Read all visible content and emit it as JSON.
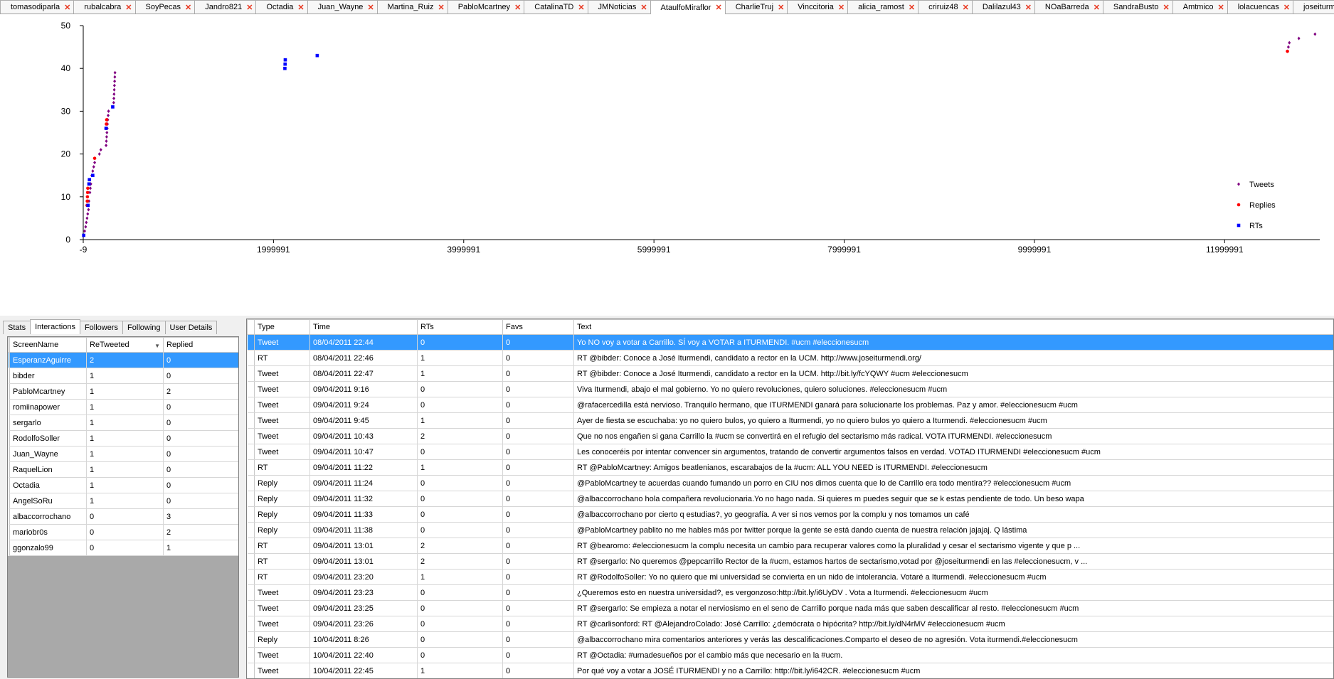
{
  "tabs": [
    {
      "label": "tomasodiparla",
      "active": false
    },
    {
      "label": "rubalcabra",
      "active": false
    },
    {
      "label": "SoyPecas",
      "active": false
    },
    {
      "label": "Jandro821",
      "active": false
    },
    {
      "label": "Octadia",
      "active": false
    },
    {
      "label": "Juan_Wayne",
      "active": false
    },
    {
      "label": "Martina_Ruiz",
      "active": false
    },
    {
      "label": "PabloMcartney",
      "active": false
    },
    {
      "label": "CatalinaTD",
      "active": false
    },
    {
      "label": "JMNoticias",
      "active": false
    },
    {
      "label": "AtaulfoMiraflor",
      "active": true
    },
    {
      "label": "CharlieTruj",
      "active": false
    },
    {
      "label": "Vinccitoria",
      "active": false
    },
    {
      "label": "alicia_ramost",
      "active": false
    },
    {
      "label": "criruiz48",
      "active": false
    },
    {
      "label": "Dalilazul43",
      "active": false
    },
    {
      "label": "NOaBarreda",
      "active": false
    },
    {
      "label": "SandraBusto",
      "active": false
    },
    {
      "label": "Amtmico",
      "active": false
    },
    {
      "label": "lolacuencas",
      "active": false
    },
    {
      "label": "joseiturmendi",
      "active": false
    }
  ],
  "chart_data": {
    "type": "scatter",
    "xlim": [
      -9,
      12999991
    ],
    "ylim": [
      0,
      50
    ],
    "x_ticks": [
      -9,
      1999991,
      3999991,
      5999991,
      7999991,
      9999991,
      11999991
    ],
    "x_tick_labels": [
      "-9",
      "1999991",
      "3999991",
      "5999991",
      "7999991",
      "9999991",
      "11999991"
    ],
    "y_ticks": [
      0,
      10,
      20,
      30,
      40,
      50
    ],
    "y_tick_labels": [
      "0",
      "10",
      "20",
      "30",
      "40",
      "50"
    ],
    "legend_position": "right",
    "legend": [
      {
        "name": "Tweets",
        "color": "#800080",
        "marker": "diamond"
      },
      {
        "name": "Replies",
        "color": "#ff0000",
        "marker": "circle"
      },
      {
        "name": "RTs",
        "color": "#0000ff",
        "marker": "square"
      }
    ],
    "series": [
      {
        "name": "Tweets",
        "color": "#800080",
        "marker": "diamond",
        "points": [
          [
            5000,
            1
          ],
          [
            15000,
            2
          ],
          [
            25000,
            3
          ],
          [
            32000,
            4
          ],
          [
            40000,
            5
          ],
          [
            47000,
            6
          ],
          [
            55000,
            7
          ],
          [
            60000,
            9
          ],
          [
            70000,
            11
          ],
          [
            75000,
            12
          ],
          [
            80000,
            13
          ],
          [
            90000,
            15
          ],
          [
            100000,
            16
          ],
          [
            110000,
            17
          ],
          [
            120000,
            18
          ],
          [
            170000,
            20
          ],
          [
            185000,
            21
          ],
          [
            240000,
            22
          ],
          [
            243000,
            23
          ],
          [
            246000,
            24
          ],
          [
            249000,
            25
          ],
          [
            252000,
            26
          ],
          [
            255000,
            27
          ],
          [
            258000,
            28
          ],
          [
            262000,
            29
          ],
          [
            266000,
            30
          ],
          [
            320000,
            32
          ],
          [
            322000,
            33
          ],
          [
            324000,
            34
          ],
          [
            326000,
            35
          ],
          [
            328000,
            36
          ],
          [
            330000,
            37
          ],
          [
            332000,
            38
          ],
          [
            334000,
            39
          ],
          [
            12660000,
            44
          ],
          [
            12670000,
            45
          ],
          [
            12680000,
            46
          ],
          [
            12780000,
            47
          ],
          [
            12950000,
            48
          ]
        ]
      },
      {
        "name": "Replies",
        "color": "#ff0000",
        "marker": "circle",
        "points": [
          [
            40000,
            8
          ],
          [
            42000,
            9
          ],
          [
            44000,
            10
          ],
          [
            46000,
            11
          ],
          [
            48000,
            12
          ],
          [
            120000,
            19
          ],
          [
            240000,
            26
          ],
          [
            243000,
            27
          ],
          [
            246000,
            28
          ],
          [
            12660000,
            44
          ]
        ]
      },
      {
        "name": "RTs",
        "color": "#0000ff",
        "marker": "square",
        "points": [
          [
            5000,
            1
          ],
          [
            50000,
            8
          ],
          [
            60000,
            13
          ],
          [
            65000,
            14
          ],
          [
            100000,
            15
          ],
          [
            240000,
            26
          ],
          [
            310000,
            31
          ],
          [
            2120000,
            40
          ],
          [
            2122000,
            41
          ],
          [
            2124000,
            42
          ],
          [
            2460000,
            43
          ]
        ]
      }
    ]
  },
  "left_tabs": [
    {
      "label": "Stats",
      "active": false
    },
    {
      "label": "Interactions",
      "active": true
    },
    {
      "label": "Followers",
      "active": false
    },
    {
      "label": "Following",
      "active": false
    },
    {
      "label": "User Details",
      "active": false
    }
  ],
  "interactions": {
    "columns": [
      "ScreenName",
      "ReTweeted",
      "Replied"
    ],
    "rows": [
      [
        "EsperanzAguirre",
        "2",
        "0"
      ],
      [
        "bibder",
        "1",
        "0"
      ],
      [
        "PabloMcartney",
        "1",
        "2"
      ],
      [
        "romiinapower",
        "1",
        "0"
      ],
      [
        "sergarlo",
        "1",
        "0"
      ],
      [
        "RodolfoSoller",
        "1",
        "0"
      ],
      [
        "Juan_Wayne",
        "1",
        "0"
      ],
      [
        "RaquelLion",
        "1",
        "0"
      ],
      [
        "Octadia",
        "1",
        "0"
      ],
      [
        "AngelSoRu",
        "1",
        "0"
      ],
      [
        "albaccorrochano",
        "0",
        "3"
      ],
      [
        "mariobr0s",
        "0",
        "2"
      ],
      [
        "ggonzalo99",
        "0",
        "1"
      ]
    ]
  },
  "tweets": {
    "columns": [
      "Type",
      "Time",
      "RTs",
      "Favs",
      "Text"
    ],
    "rows": [
      [
        "Tweet",
        "08/04/2011 22:44",
        "0",
        "0",
        "Yo NO voy a votar a Carrillo. SÍ voy a VOTAR a ITURMENDI. #ucm #eleccionesucm"
      ],
      [
        "RT",
        "08/04/2011 22:46",
        "1",
        "0",
        "RT @bibder: Conoce a José Iturmendi, candidato a rector en la UCM. http://www.joseiturmendi.org/"
      ],
      [
        "Tweet",
        "08/04/2011 22:47",
        "1",
        "0",
        "RT @bibder: Conoce a José Iturmendi, candidato a rector en la UCM. http://bit.ly/fcYQWY #ucm #eleccionesucm"
      ],
      [
        "Tweet",
        "09/04/2011 9:16",
        "0",
        "0",
        "Viva Iturmendi, abajo el mal gobierno. Yo no quiero revoluciones, quiero soluciones. #eleccionesucm #ucm"
      ],
      [
        "Tweet",
        "09/04/2011 9:24",
        "0",
        "0",
        "@rafacercedilla está nervioso. Tranquilo hermano, que ITURMENDI ganará para solucionarte los problemas. Paz y amor. #eleccionesucm #ucm"
      ],
      [
        "Tweet",
        "09/04/2011 9:45",
        "1",
        "0",
        "Ayer de fiesta se escuchaba: yo no quiero bulos, yo quiero a Iturmendi, yo no quiero bulos yo quiero a Iturmendi. #eleccionesucm #ucm"
      ],
      [
        "Tweet",
        "09/04/2011 10:43",
        "2",
        "0",
        "Que no nos engañen si gana Carrillo la #ucm se convertirá en el refugio del sectarismo más radical. VOTA ITURMENDI. #eleccionesucm"
      ],
      [
        "Tweet",
        "09/04/2011 10:47",
        "0",
        "0",
        "Les conoceréis por intentar convencer sin argumentos, tratando de convertir argumentos falsos en verdad. VOTAD ITURMENDI #eleccionesucm #ucm"
      ],
      [
        "RT",
        "09/04/2011 11:22",
        "1",
        "0",
        "RT @PabloMcartney: Amigos beatlenianos, escarabajos de la #ucm: ALL YOU NEED is ITURMENDI. #eleccionesucm"
      ],
      [
        "Reply",
        "09/04/2011 11:24",
        "0",
        "0",
        "@PabloMcartney te acuerdas cuando fumando un porro en CIU nos dimos cuenta que lo de Carrillo era todo mentira?? #eleccionesucm #ucm"
      ],
      [
        "Reply",
        "09/04/2011 11:32",
        "0",
        "0",
        "@albaccorrochano hola compañera revolucionaria.Yo no hago nada. Si quieres m puedes seguir que se k estas pendiente de todo. Un beso wapa"
      ],
      [
        "Reply",
        "09/04/2011 11:33",
        "0",
        "0",
        "@albaccorrochano por cierto q estudias?, yo geografía. A ver si nos vemos por la complu y nos tomamos un café"
      ],
      [
        "Reply",
        "09/04/2011 11:38",
        "0",
        "0",
        "@PabloMcartney pablito no me hables más por twitter porque la gente se está dando cuenta de nuestra relación jajajaj. Q lástima"
      ],
      [
        "RT",
        "09/04/2011 13:01",
        "2",
        "0",
        "RT @bearomo: #eleccionesucm la complu necesita un cambio para recuperar valores como la pluralidad y cesar el sectarismo vigente y que p ..."
      ],
      [
        "RT",
        "09/04/2011 13:01",
        "2",
        "0",
        "RT @sergarlo: No queremos @pepcarrillo Rector de la #ucm, estamos hartos de sectarismo,votad por @joseiturmendi en las #eleccionesucm, v ..."
      ],
      [
        "RT",
        "09/04/2011 23:20",
        "1",
        "0",
        "RT @RodolfoSoller: Yo no quiero que mi universidad se convierta en un nido de intolerancia. Votaré a Iturmendi. #eleccionesucm #ucm"
      ],
      [
        "Tweet",
        "09/04/2011 23:23",
        "0",
        "0",
        "¿Queremos esto en nuestra universidad?, es vergonzoso:http://bit.ly/i6UyDV . Vota a Iturmendi. #eleccionesucm #ucm"
      ],
      [
        "Tweet",
        "09/04/2011 23:25",
        "0",
        "0",
        "RT @sergarlo: Se empieza a notar el nerviosismo en el seno de Carrillo porque nada más que saben descalificar al resto. #eleccionesucm #ucm"
      ],
      [
        "Tweet",
        "09/04/2011 23:26",
        "0",
        "0",
        "RT @carlisonford: RT @AlejandroColado: José Carrillo: ¿demócrata o hipócrita? http://bit.ly/dN4rMV #eleccionesucm #ucm"
      ],
      [
        "Reply",
        "10/04/2011 8:26",
        "0",
        "0",
        "@albaccorrochano mira comentarios anteriores y verás las descalificaciones.Comparto el deseo de no agresión. Vota iturmendi.#eleccionesucm"
      ],
      [
        "Tweet",
        "10/04/2011 22:40",
        "0",
        "0",
        "RT @Octadia: #urnadesueños por el cambio más que necesario en la #ucm."
      ],
      [
        "Tweet",
        "10/04/2011 22:45",
        "1",
        "0",
        "Por qué voy a votar a JOSÉ ITURMENDI y no a Carrillo: http://bit.ly/i642CR. #eleccionesucm #ucm"
      ]
    ]
  }
}
